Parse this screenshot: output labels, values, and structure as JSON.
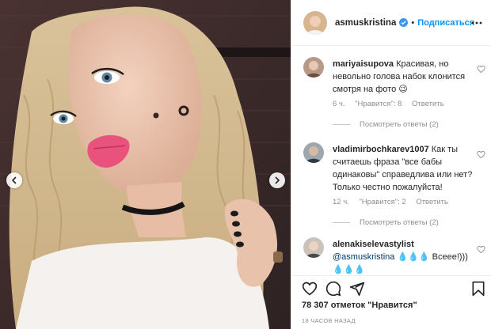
{
  "post": {
    "username": "asmuskristina",
    "follow_label": "Подписаться",
    "dot": "•",
    "likes_text": "78 307 отметок \"Нравится\"",
    "time_ago": "18 ЧАСОВ НАЗАД"
  },
  "comments": [
    {
      "username": "mariyaisupova",
      "text": " Красивая, но невольно голова набок клонится смотря на фото 😉",
      "time": "6 ч.",
      "likes": "\"Нравится\": 8",
      "reply_label": "Ответить",
      "view_replies": "Посмотреть ответы (2)"
    },
    {
      "username": "vladimirbochkarev1007",
      "text": " Как ты считаешь фраза \"все бабы одинаковы\" справедлива или нет? Только честно пожалуйста!",
      "time": "12 ч.",
      "likes": "\"Нравится\": 2",
      "reply_label": "Ответить",
      "view_replies": "Посмотреть ответы (2)"
    },
    {
      "username": "alenakiselevastylist",
      "mention": "@asmuskristina",
      "text": " 💧💧💧 Всеее!))) 💧💧💧"
    }
  ],
  "icons": {
    "like": "heart-icon",
    "comment": "comment-icon",
    "share": "share-icon",
    "save": "bookmark-icon",
    "verified": "verified-badge-icon",
    "more": "more-options-icon",
    "prev": "chevron-left-icon",
    "next": "chevron-right-icon"
  },
  "colors": {
    "link_blue": "#0095f6",
    "text": "#262626",
    "muted": "#8e8e8e",
    "lips": "#e8527c"
  }
}
